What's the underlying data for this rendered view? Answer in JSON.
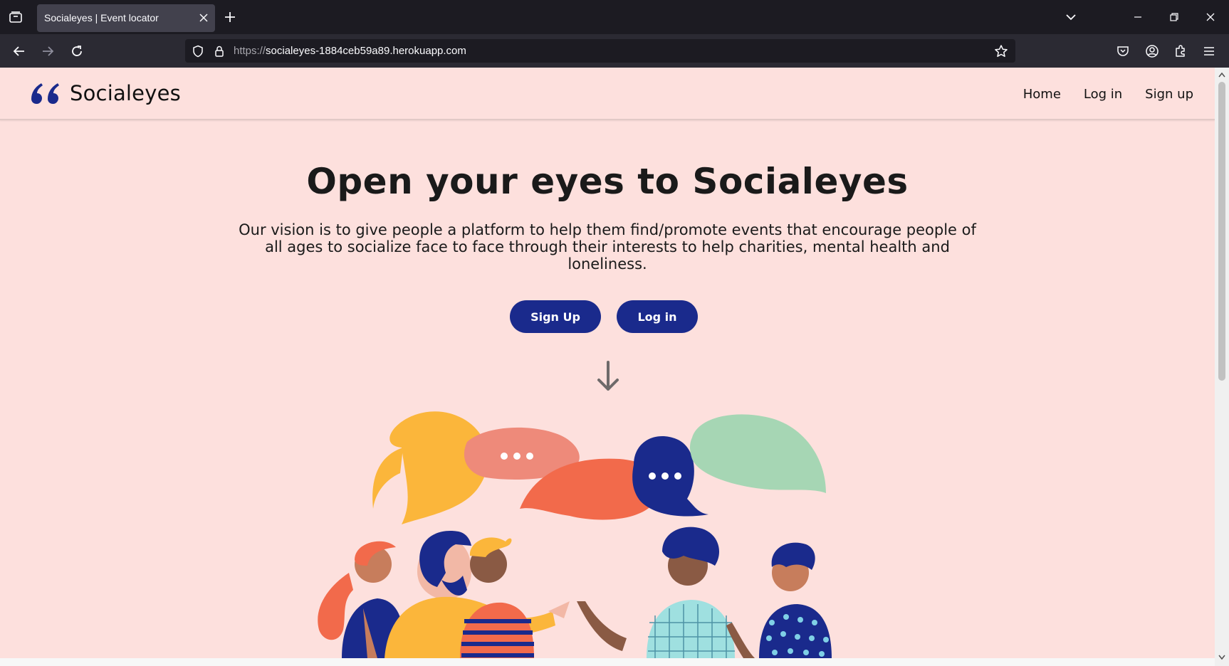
{
  "browser": {
    "tab_title": "Socialeyes | Event locator",
    "url_scheme": "https://",
    "url_host": "socialeyes-1884ceb59a89.herokuapp.com"
  },
  "site": {
    "brand": "Socialeyes",
    "nav": [
      "Home",
      "Log in",
      "Sign up"
    ]
  },
  "hero": {
    "title": "Open your eyes to Socialeyes",
    "description": "Our vision is to give people a platform to help them find/promote events that encourage people of all ages to socialize face to face through their interests to help charities, mental health and loneliness.",
    "signup_label": "Sign Up",
    "login_label": "Log in"
  },
  "colors": {
    "page_bg": "#fde0dd",
    "brand_navy": "#1a2a8c",
    "yellow": "#fbb63b",
    "coral": "#f26a4b",
    "salmon": "#ee8a7a",
    "mint": "#a6d6b4"
  }
}
